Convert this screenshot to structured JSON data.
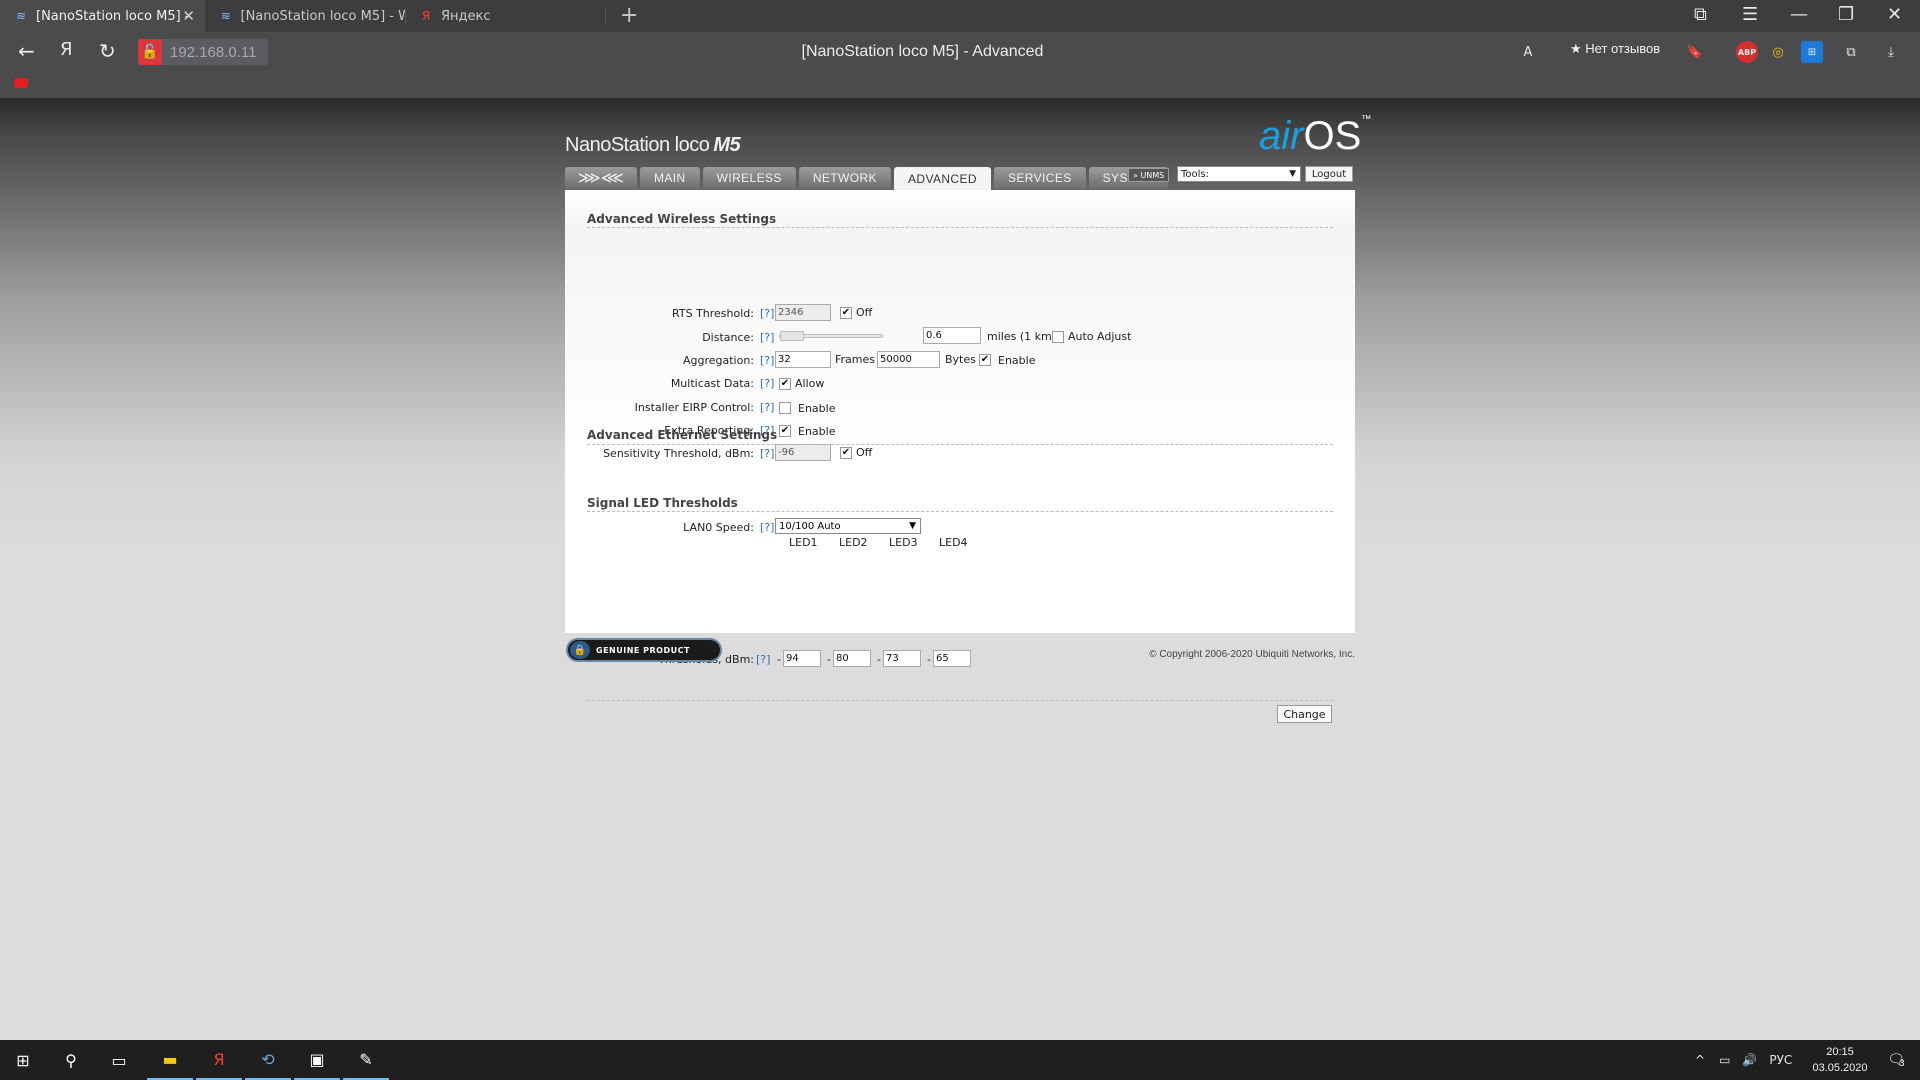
{
  "browser": {
    "tabs": [
      {
        "title": "[NanoStation loco M5] -",
        "active": true
      },
      {
        "title": "[NanoStation loco M5] - W",
        "active": false
      },
      {
        "title": "Яндекс",
        "active": false
      }
    ],
    "url": "192.168.0.11",
    "page_heading": "[NanoStation loco M5] - Advanced",
    "reviews": "★ Нет отзывов",
    "yandex_glyph": "Я",
    "abp_label": "ABP"
  },
  "header": {
    "device_name": "NanoStation loco",
    "device_model": "M5",
    "logo_air": "air",
    "logo_os": "OS",
    "logo_tm": "™"
  },
  "nav": {
    "tabs": [
      "MAIN",
      "WIRELESS",
      "NETWORK",
      "ADVANCED",
      "SERVICES",
      "SYSTEM"
    ],
    "active": "ADVANCED",
    "unms": "» UNMS",
    "tools": "Tools:",
    "logout": "Logout"
  },
  "wireless": {
    "title": "Advanced Wireless Settings",
    "help": "[?]",
    "rts_label": "RTS Threshold:",
    "rts_value": "2346",
    "rts_off": "Off",
    "distance_label": "Distance:",
    "distance_value": "0.6",
    "distance_unit": "miles (1 km)",
    "auto_adjust": "Auto Adjust",
    "aggregation_label": "Aggregation:",
    "agg_frames_value": "32",
    "agg_frames": "Frames",
    "agg_bytes_value": "50000",
    "agg_bytes": "Bytes",
    "agg_enable": "Enable",
    "multicast_label": "Multicast Data:",
    "multicast_allow": "Allow",
    "eirp_label": "Installer EIRP Control:",
    "eirp_enable": "Enable",
    "extra_label": "Extra Reporting:",
    "extra_enable": "Enable",
    "sens_label": "Sensitivity Threshold, dBm:",
    "sens_value": "-96",
    "sens_off": "Off"
  },
  "ethernet": {
    "title": "Advanced Ethernet Settings",
    "lan_label": "LAN0 Speed:",
    "lan_value": "10/100 Auto"
  },
  "led": {
    "title": "Signal LED Thresholds",
    "headers": [
      "LED1",
      "LED2",
      "LED3",
      "LED4"
    ],
    "label": "Thresholds, dBm:",
    "dash": "-",
    "values": [
      "94",
      "80",
      "73",
      "65"
    ]
  },
  "footer": {
    "change": "Change",
    "genuine": "GENUINE PRODUCT",
    "copyright": "© Copyright 2006-2020 Ubiquiti Networks, Inc."
  },
  "taskbar": {
    "lang": "РУС",
    "time": "20:15",
    "date": "03.05.2020",
    "notifications": "3"
  }
}
